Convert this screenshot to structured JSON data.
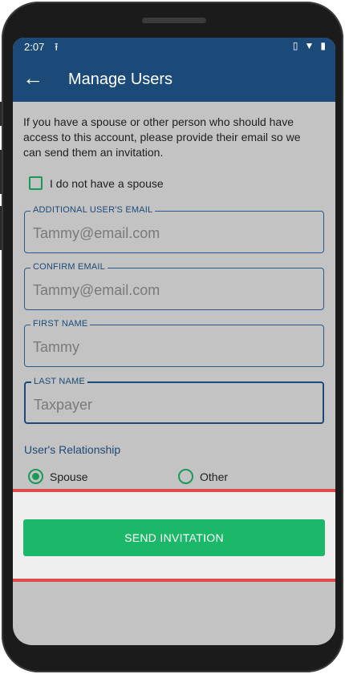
{
  "status_bar": {
    "time": "2:07",
    "upload_icon": "upload-icon",
    "icons": [
      "vibrate-icon",
      "wifi-icon",
      "battery-icon"
    ]
  },
  "appbar": {
    "back_icon": "arrow-left-icon",
    "title": "Manage Users"
  },
  "intro_text": "If you have a spouse or other person who should have access to this account, please provide their email so we can send them an invitation.",
  "no_spouse_checkbox": {
    "label": "I do not have a spouse",
    "checked": false
  },
  "fields": [
    {
      "label": "ADDITIONAL USER'S EMAIL",
      "value": "Tammy@email.com"
    },
    {
      "label": "CONFIRM EMAIL",
      "value": "Tammy@email.com"
    },
    {
      "label": "FIRST NAME",
      "value": "Tammy"
    },
    {
      "label": "LAST NAME",
      "value": "Taxpayer"
    }
  ],
  "relationship": {
    "title": "User's Relationship",
    "options": [
      {
        "label": "Spouse",
        "selected": true
      },
      {
        "label": "Other",
        "selected": false
      }
    ]
  },
  "send_button": {
    "label": "SEND INVITATION"
  },
  "colors": {
    "header": "#1c4a78",
    "accent_green": "#1cb86a",
    "highlight_red": "#e04a4a",
    "screen_overlay": "#c3c3c3"
  }
}
